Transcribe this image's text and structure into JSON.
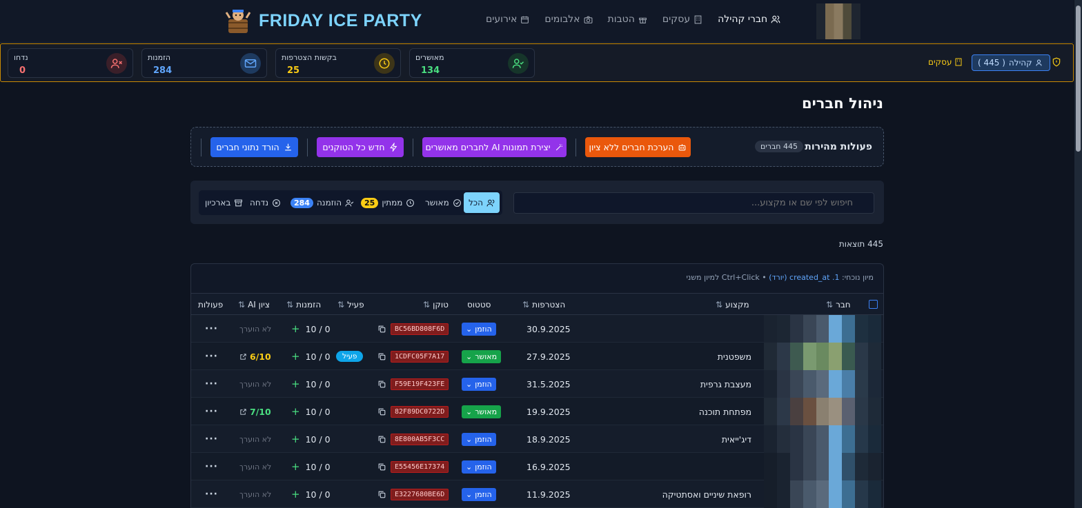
{
  "app": {
    "title": "FRIDAY ICE PARTY",
    "nav": [
      {
        "label": "חברי קהילה",
        "icon": "users-icon",
        "active": true
      },
      {
        "label": "עסקים",
        "icon": "building-icon",
        "active": false
      },
      {
        "label": "הטבות",
        "icon": "gift-icon",
        "active": false
      },
      {
        "label": "אלבומים",
        "icon": "camera-icon",
        "active": false
      },
      {
        "label": "אירועים",
        "icon": "calendar-icon",
        "active": false
      }
    ]
  },
  "stats": {
    "approved": {
      "label": "מאושרים",
      "value": "134",
      "color": "#4ade80"
    },
    "requests": {
      "label": "בקשות הצטרפות",
      "value": "25",
      "color": "#facc15"
    },
    "invites": {
      "label": "הזמנות",
      "value": "284",
      "color": "#60a5fa"
    },
    "rejected": {
      "label": "נדחו",
      "value": "0",
      "color": "#f87171"
    },
    "community_label": "קהילה",
    "community_count": "( 445 )",
    "businesses_label": "עסקים"
  },
  "page": {
    "title": "ניהול חברים"
  },
  "quick_actions": {
    "title": "פעולות מהירות",
    "count": "445 חברים",
    "rate_unrated": "הערכת חברים ללא ציון",
    "ai_images": "יצירת תמונות AI לחברים מאושרים",
    "renew_tokens": "חדש כל הטוקנים",
    "download": "הורד נתוני חברים"
  },
  "filters": {
    "search_placeholder": "חיפוש לפי שם או מקצוע...",
    "tabs": {
      "all": "הכל",
      "approved": "מאושר",
      "pending": "ממתין",
      "pending_count": "25",
      "invited": "הוזמנה",
      "invited_count": "284",
      "rejected": "נדחה",
      "archive": "בארכיון"
    }
  },
  "results": "445 תוצאות",
  "sort": {
    "prefix": "מיון נוכחי:",
    "current": "1. created_at (יורד)",
    "hint": "Ctrl+Click למיון משני"
  },
  "columns": {
    "member": "חבר",
    "profession": "מקצוע",
    "joined": "הצטרפות",
    "status": "סטטוס",
    "token": "טוקן",
    "active": "פעיל",
    "invites": "הזמנות",
    "ai_score": "ציון AI",
    "actions": "פעולות"
  },
  "rows": [
    {
      "profession": "",
      "joined": "30.9.2025",
      "status": "הוזמן",
      "status_color": "#2563eb",
      "token": "BC56BD808F6D",
      "active": "",
      "invites": "0 / 10",
      "score": "לא הוערך",
      "scored": false
    },
    {
      "profession": "משפטנית",
      "joined": "27.9.2025",
      "status": "מאושר",
      "status_color": "#16a34a",
      "token": "1CDFC05F7A17",
      "active": "פעיל",
      "invites": "0 / 10",
      "score": "6/10",
      "scored": true,
      "score_color": "#facc15"
    },
    {
      "profession": "מעצבת גרפית",
      "joined": "31.5.2025",
      "status": "הוזמן",
      "status_color": "#2563eb",
      "token": "F59E19F423FE",
      "active": "",
      "invites": "0 / 10",
      "score": "לא הוערך",
      "scored": false
    },
    {
      "profession": "מפתחת תוכנה",
      "joined": "19.9.2025",
      "status": "מאושר",
      "status_color": "#16a34a",
      "token": "82F89DC0722D",
      "active": "",
      "invites": "0 / 10",
      "score": "7/10",
      "scored": true,
      "score_color": "#4ade80"
    },
    {
      "profession": "דיג'ייאית",
      "joined": "18.9.2025",
      "status": "הוזמן",
      "status_color": "#2563eb",
      "token": "8E800AB5F3CC",
      "active": "",
      "invites": "0 / 10",
      "score": "לא הוערך",
      "scored": false
    },
    {
      "profession": "",
      "joined": "16.9.2025",
      "status": "הוזמן",
      "status_color": "#2563eb",
      "token": "E55456E17374",
      "active": "",
      "invites": "0 / 10",
      "score": "לא הוערך",
      "scored": false
    },
    {
      "profession": "רופאת שיניים ואסתטיקה",
      "joined": "11.9.2025",
      "status": "הוזמן",
      "status_color": "#2563eb",
      "token": "E3227680BE6D",
      "active": "",
      "invites": "0 / 10",
      "score": "לא הוערך",
      "scored": false
    }
  ]
}
